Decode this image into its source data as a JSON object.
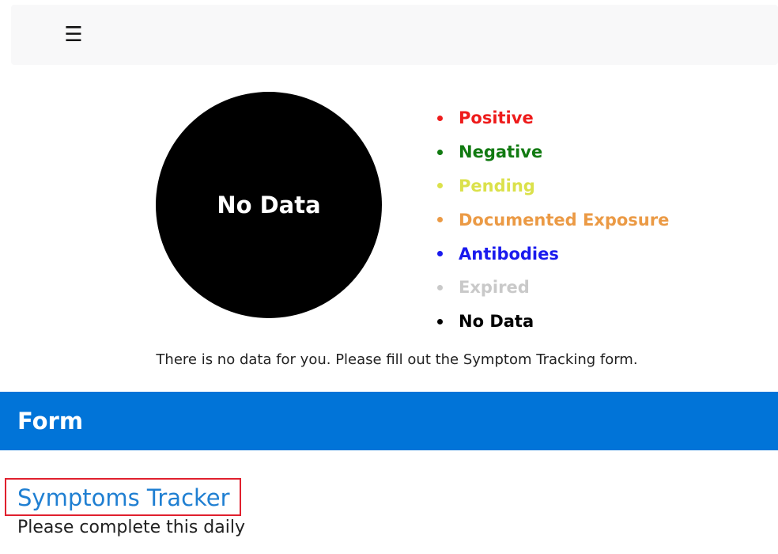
{
  "navbar": {
    "menu_icon": "☰"
  },
  "status": {
    "circle_label": "No Data",
    "circle_color": "#000000",
    "legend": [
      {
        "label": "Positive",
        "color": "#ee1c1c"
      },
      {
        "label": "Negative",
        "color": "#117a11"
      },
      {
        "label": "Pending",
        "color": "#dbe14b"
      },
      {
        "label": "Documented Exposure",
        "color": "#eb9a45"
      },
      {
        "label": "Antibodies",
        "color": "#1a1aee"
      },
      {
        "label": "Expired",
        "color": "#c9c9c9"
      },
      {
        "label": "No Data",
        "color": "#000000"
      }
    ],
    "message": "There is no data for you. Please fill out the Symptom Tracking form."
  },
  "form_section": {
    "title": "Form",
    "bar_color": "#0174d8",
    "tracker": {
      "link_text": "Symptoms Tracker",
      "subtitle": "Please complete this daily"
    }
  }
}
